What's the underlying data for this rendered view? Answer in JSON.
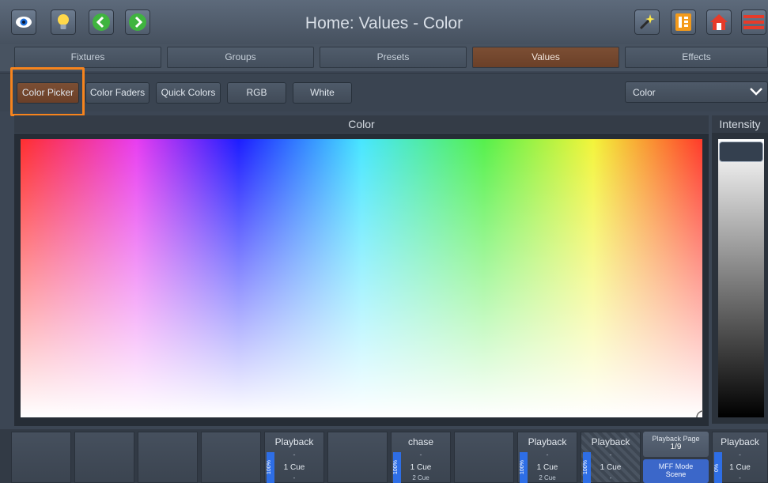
{
  "header": {
    "title": "Home: Values - Color",
    "icons_left": [
      "eye-icon",
      "lightbulb-icon",
      "back-icon",
      "forward-icon"
    ],
    "icons_right": [
      "magic-wand-icon",
      "playback-list-icon",
      "home-icon",
      "menu-icon"
    ]
  },
  "tabs": [
    {
      "label": "Fixtures",
      "active": false
    },
    {
      "label": "Groups",
      "active": false
    },
    {
      "label": "Presets",
      "active": false
    },
    {
      "label": "Values",
      "active": true
    },
    {
      "label": "Effects",
      "active": false
    }
  ],
  "subtabs": [
    {
      "label": "Color Picker",
      "active": true
    },
    {
      "label": "Color Faders",
      "active": false
    },
    {
      "label": "Quick Colors",
      "active": false
    },
    {
      "label": "RGB",
      "active": false
    },
    {
      "label": "White",
      "active": false
    }
  ],
  "dropdown": {
    "value": "Color"
  },
  "picker": {
    "title": "Color"
  },
  "intensity": {
    "title": "Intensity",
    "level": 1.0
  },
  "colors": {
    "accent": "#f7841d",
    "active_tab": "#6f432c",
    "level_blue": "#2e6ee6"
  },
  "playbacks": [
    {
      "title": "",
      "empty": true
    },
    {
      "title": "",
      "empty": true
    },
    {
      "title": "",
      "empty": true
    },
    {
      "title": "",
      "empty": true
    },
    {
      "title": "Playback",
      "sub": "-",
      "level": "100%",
      "cue1": "1 Cue",
      "cue2": "-"
    },
    {
      "title": "",
      "empty": true
    },
    {
      "title": "chase",
      "sub": "-",
      "level": "100%",
      "cue1": "1 Cue",
      "cue2": "2 Cue"
    },
    {
      "title": "",
      "empty": true
    },
    {
      "title": "Playback",
      "sub": "-",
      "level": "100%",
      "cue1": "1 Cue",
      "cue2": "2 Cue"
    },
    {
      "title": "Playback",
      "sub": "-",
      "level": "100%",
      "cue1": "1 Cue",
      "cue2": "-",
      "hatched": true
    },
    {
      "page_label": "Playback Page",
      "page_value": "1/9",
      "mff_label": "MFF Mode",
      "mff_value": "Scene"
    },
    {
      "title": "Playback",
      "sub": "-",
      "level": "0%",
      "cue1": "1 Cue",
      "cue2": "-"
    }
  ]
}
